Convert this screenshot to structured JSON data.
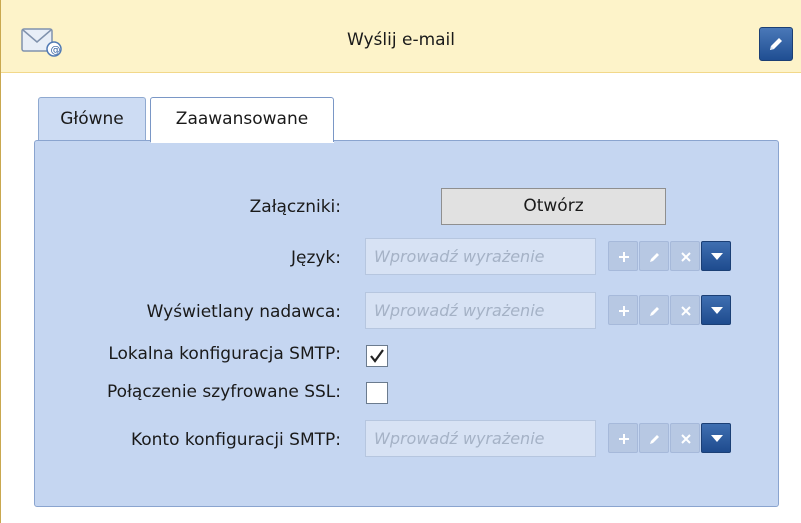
{
  "header": {
    "title": "Wyślij e-mail",
    "icon": "mail-icon",
    "edit_icon": "pencil-icon"
  },
  "tabs": [
    {
      "label": "Główne",
      "active": false
    },
    {
      "label": "Zaawansowane",
      "active": true
    }
  ],
  "form": {
    "attachments": {
      "label": "Załączniki:",
      "button_label": "Otwórz"
    },
    "language": {
      "label": "Język:",
      "placeholder": "Wprowadź wyrażenie"
    },
    "sender": {
      "label": "Wyświetlany nadawca:",
      "placeholder": "Wprowadź wyrażenie"
    },
    "local_smtp": {
      "label": "Lokalna konfiguracja SMTP:",
      "checked": true
    },
    "ssl": {
      "label": "Połączenie szyfrowane SSL:",
      "checked": false
    },
    "smtp_account": {
      "label": "Konto konfiguracji SMTP:",
      "placeholder": "Wprowadź wyrażenie"
    }
  },
  "colors": {
    "header_bg": "#fdf3c9",
    "panel_bg": "#c5d6f1",
    "accent_button": "#2a5aa0"
  }
}
